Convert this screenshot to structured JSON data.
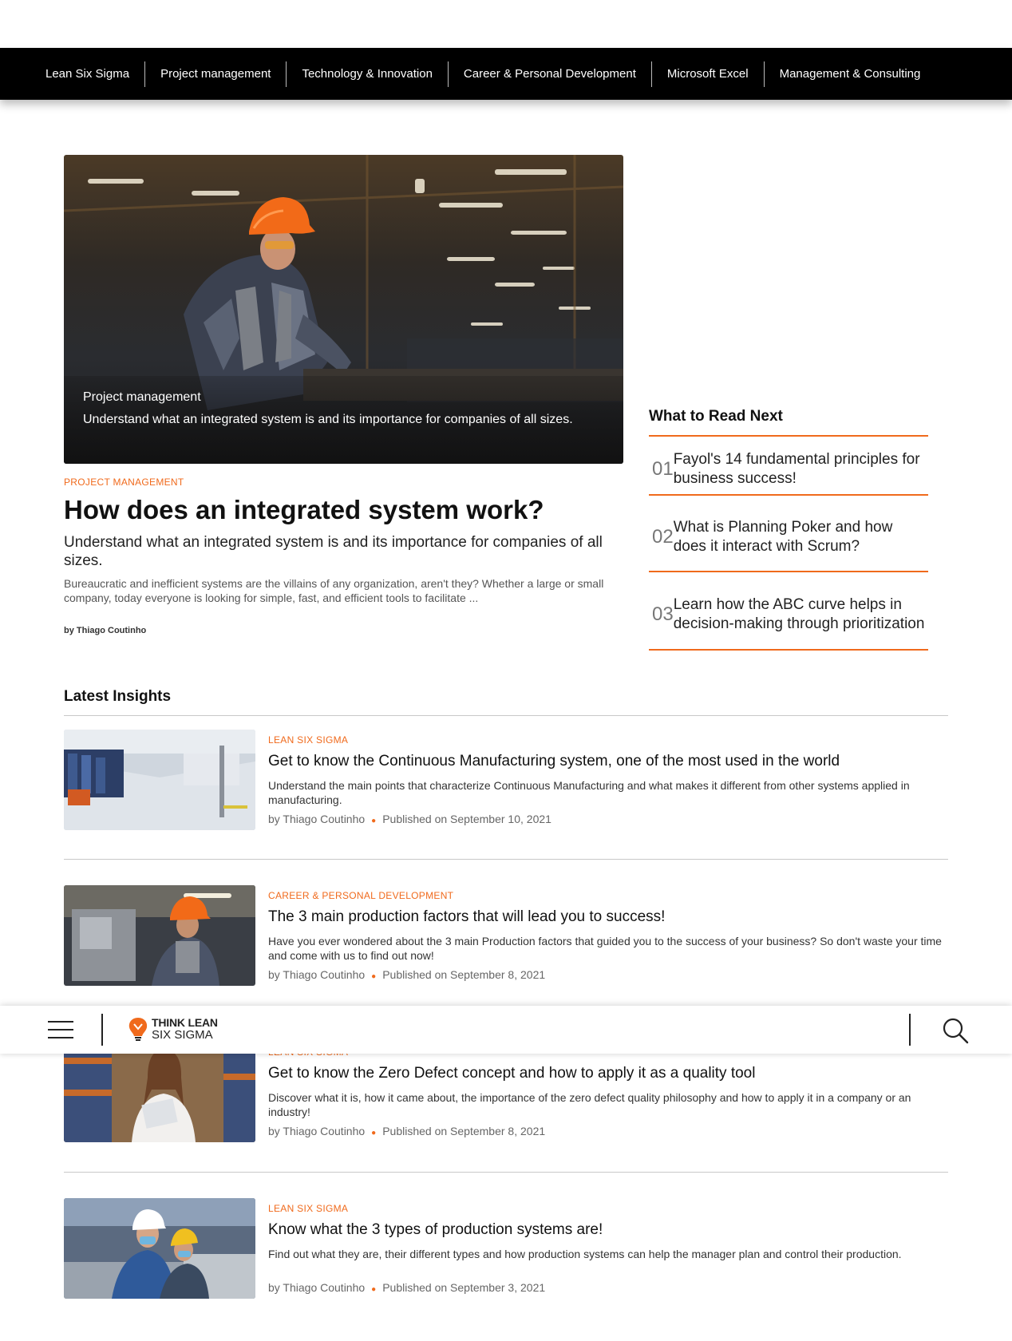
{
  "nav": {
    "items": [
      "Lean Six Sigma",
      "Project management",
      "Technology & Innovation",
      "Career & Personal Development",
      "Microsoft Excel",
      "Management & Consulting"
    ]
  },
  "hero": {
    "category": "Project management",
    "caption": "Understand what an integrated system is and its importance for companies of all sizes."
  },
  "featured": {
    "category": "PROJECT MANAGEMENT",
    "title": "How does an integrated system work?",
    "subtitle": "Understand what an integrated system is and its importance for companies of all sizes.",
    "excerpt": "Bureaucratic and inefficient systems are the villains of any organization, aren't they? Whether a large or small company, today everyone is looking for simple, fast, and efficient tools to facilitate ...",
    "byline": "by Thiago Coutinho"
  },
  "read_next": {
    "title": "What to Read Next",
    "items": [
      {
        "num": "01",
        "text": "Fayol's 14 fundamental principles for business success!"
      },
      {
        "num": "02",
        "text": "What is Planning Poker and how does it interact with Scrum?"
      },
      {
        "num": "03",
        "text": "Learn how the ABC curve helps in decision-making through prioritization"
      }
    ]
  },
  "latest": {
    "title": "Latest Insights",
    "articles": [
      {
        "category": "LEAN SIX SIGMA",
        "title": "Get to know the Continuous Manufacturing system, one of the most used in the world",
        "desc": "Understand the main points that characterize Continuous Manufacturing and what makes it different from other systems applied in manufacturing.",
        "author": "by Thiago Coutinho",
        "date": "Published on September 10, 2021"
      },
      {
        "category": "CAREER & PERSONAL DEVELOPMENT",
        "title": "The 3 main production factors that will lead you to success!",
        "desc": "Have you ever wondered about the 3 main Production factors that guided you to the success of your business? So don't waste your time and come with us to find out now!",
        "author": "by Thiago Coutinho",
        "date": "Published on September 8, 2021"
      },
      {
        "category": "LEAN SIX SIGMA",
        "title": "Get to know the Zero Defect concept and how to apply it as a quality tool",
        "desc": "Discover what it is, how it came about, the importance of the zero defect quality philosophy and how to apply it in a company or an industry!",
        "author": "by Thiago Coutinho",
        "date": "Published on September 8, 2021"
      },
      {
        "category": "LEAN SIX SIGMA",
        "title": "Know what the 3 types of production systems are!",
        "desc": "Find out what they are, their different types and how production systems can help the manager plan and control their production.",
        "author": "by Thiago Coutinho",
        "date": "Published on September 3, 2021"
      }
    ]
  },
  "bottombar": {
    "logo_line1": "THINK LEAN",
    "logo_line2": "SIX SIGMA"
  },
  "colors": {
    "accent": "#f06a1c",
    "nav_bg": "#000000"
  },
  "icons": [
    "menu-icon",
    "logo-bulb-icon",
    "search-icon"
  ]
}
